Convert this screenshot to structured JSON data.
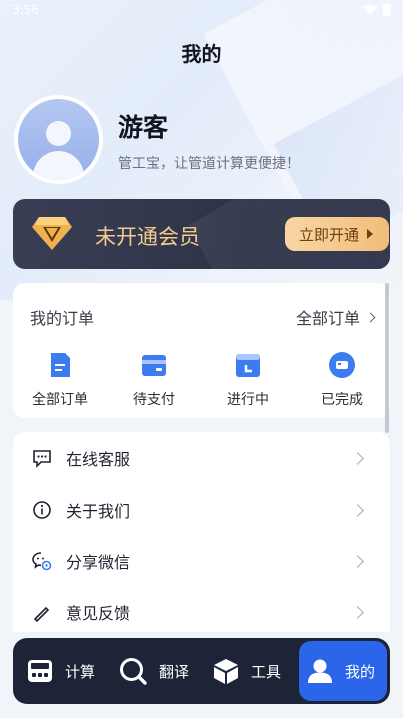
{
  "status_bar": {
    "time": "3:56"
  },
  "header": {
    "title": "我的"
  },
  "profile": {
    "name": "游客",
    "slogan": "管工宝，让管道计算更便捷！"
  },
  "vip": {
    "label": "未开通会员",
    "button_label": "立即开通"
  },
  "orders": {
    "title": "我的订单",
    "all_label": "全部订单",
    "items": [
      {
        "label": "全部订单",
        "icon": "all-orders-icon"
      },
      {
        "label": "待支付",
        "icon": "wallet-icon"
      },
      {
        "label": "进行中",
        "icon": "in-progress-icon"
      },
      {
        "label": "已完成",
        "icon": "completed-icon"
      }
    ]
  },
  "menu": {
    "items": [
      {
        "label": "在线客服",
        "icon": "chat-icon"
      },
      {
        "label": "关于我们",
        "icon": "info-icon"
      },
      {
        "label": "分享微信",
        "icon": "share-wechat-icon"
      },
      {
        "label": "意见反馈",
        "icon": "feedback-icon"
      }
    ]
  },
  "bottom_nav": {
    "items": [
      {
        "label": "计算",
        "icon": "calculator-icon"
      },
      {
        "label": "翻译",
        "icon": "search-icon"
      },
      {
        "label": "工具",
        "icon": "box-icon"
      },
      {
        "label": "我的",
        "icon": "user-icon"
      }
    ],
    "active_index": 3
  },
  "colors": {
    "accent": "#2b66ea",
    "nav_bg": "#1e2438",
    "vip_gold": "#f3cc8d",
    "order_icon_blue": "#3d7cf0"
  }
}
